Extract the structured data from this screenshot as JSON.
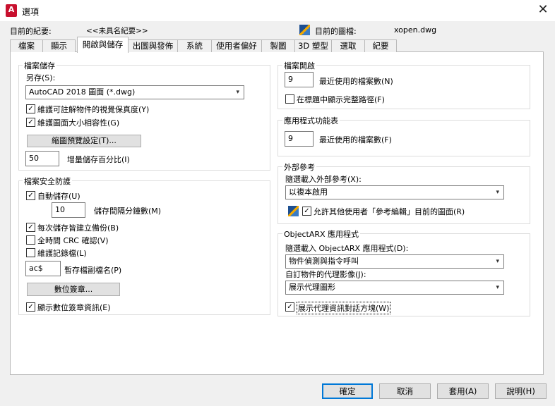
{
  "window": {
    "title": "選項",
    "close_glyph": "✕"
  },
  "header": {
    "profile_label": "目前的紀要:",
    "profile_value": "<<未具名紀要>>",
    "drawing_label": "目前的圖檔:",
    "drawing_value": "xopen.dwg"
  },
  "tabs": [
    "檔案",
    "顯示",
    "開啟與儲存",
    "出圖與發佈",
    "系統",
    "使用者偏好",
    "製圖",
    "3D 塑型",
    "選取",
    "紀要"
  ],
  "active_tab": "開啟與儲存",
  "file_save": {
    "title": "檔案儲存",
    "save_as_label": "另存(S):",
    "save_as_value": "AutoCAD 2018 圖面 (*.dwg)",
    "maintain_visual_fidelity": {
      "label": "維護可註解物件的視覺保真度(Y)",
      "checked": true
    },
    "maintain_drawing_size": {
      "label": "維護圖面大小相容性(G)",
      "checked": true
    },
    "thumbnail_button": "縮圖預覽設定(T)...",
    "incremental_value": "50",
    "incremental_label": "增量儲存百分比(I)"
  },
  "file_safety": {
    "title": "檔案安全防護",
    "autosave": {
      "label": "自動儲存(U)",
      "checked": true
    },
    "autosave_minutes_value": "10",
    "autosave_minutes_label": "儲存間隔分鐘數(M)",
    "backup": {
      "label": "每次儲存皆建立備份(B)",
      "checked": true
    },
    "crc": {
      "label": "全時間 CRC 確認(V)",
      "checked": false
    },
    "log": {
      "label": "維護記錄檔(L)",
      "checked": false
    },
    "temp_ext_value": "ac$",
    "temp_ext_label": "暫存檔副檔名(P)",
    "digital_sign_button": "數位簽章...",
    "show_sign_info": {
      "label": "顯示數位簽章資訊(E)",
      "checked": true
    }
  },
  "file_open": {
    "title": "檔案開啟",
    "recent_value": "9",
    "recent_label": "最近使用的檔案數(N)",
    "full_path": {
      "label": "在標題中顯示完整路徑(F)",
      "checked": false
    }
  },
  "app_menu": {
    "title": "應用程式功能表",
    "recent_value": "9",
    "recent_label": "最近使用的檔案數(F)"
  },
  "xref": {
    "title": "外部參考",
    "demand_load_label": "隨選載入外部參考(X):",
    "demand_load_value": "以複本啟用",
    "allow_edit": {
      "label": "允許其他使用者「參考編輯」目前的圖面(R)",
      "checked": true
    }
  },
  "objectarx": {
    "title": "ObjectARX 應用程式",
    "demand_load_label": "隨選載入 ObjectARX 應用程式(D):",
    "demand_load_value": "物件偵測與指令呼叫",
    "proxy_images_label": "自訂物件的代理影像(J):",
    "proxy_images_value": "展示代理圖形",
    "show_proxy_dialog": {
      "label": "展示代理資訊對話方塊(W)",
      "checked": true
    }
  },
  "footer": {
    "ok": "確定",
    "cancel": "取消",
    "apply": "套用(A)",
    "help": "說明(H)"
  },
  "glyphs": {
    "check": "✓",
    "dropdown": "▾"
  }
}
